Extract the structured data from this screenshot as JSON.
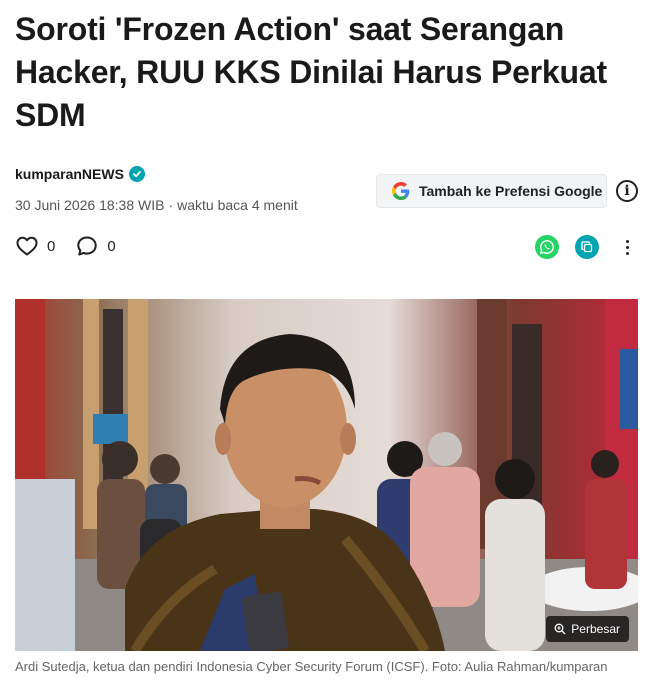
{
  "article": {
    "title": "Soroti 'Frozen Action' saat Serangan Hacker, RUU KKS Dinilai Harus Perkuat SDM",
    "author": "kumparanNEWS",
    "date": "30 Juni 2026 18:38 WIB",
    "separator": "·",
    "read_time": "waktu baca 4 menit"
  },
  "google_pref": {
    "label": "Tambah ke Prefensi Google",
    "icon": "google-g-icon"
  },
  "info_icon": "info-icon",
  "reactions": {
    "likes": "0",
    "comments": "0"
  },
  "share": {
    "whatsapp_icon": "whatsapp-icon",
    "copy_icon": "copy-link-icon",
    "more_icon": "more-vertical-icon"
  },
  "photo": {
    "zoom_label": "Perbesar",
    "caption": "Ardi Sutedja, ketua dan pendiri Indonesia Cyber Security Forum (ICSF). Foto: Aulia Rahman/kumparan"
  },
  "colors": {
    "accent": "#00a4b0",
    "whatsapp": "#25d366"
  }
}
